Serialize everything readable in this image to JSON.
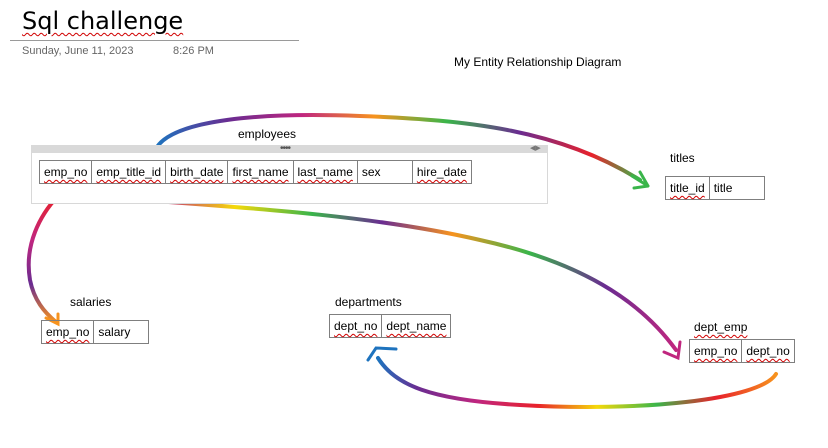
{
  "page": {
    "title": "Sql challenge",
    "date": "Sunday, June 11, 2023",
    "time": "8:26 PM"
  },
  "diagram": {
    "label": "My Entity Relationship Diagram",
    "tables": {
      "employees": {
        "name": "employees",
        "columns": [
          "emp_no",
          "emp_title_id",
          "birth_date",
          "first_name",
          "last_name",
          "sex",
          "hire_date"
        ]
      },
      "titles": {
        "name": "titles",
        "columns": [
          "title_id",
          "title"
        ]
      },
      "salaries": {
        "name": "salaries",
        "columns": [
          "emp_no",
          "salary"
        ]
      },
      "departments": {
        "name": "departments",
        "columns": [
          "dept_no",
          "dept_name"
        ]
      },
      "dept_emp": {
        "name": "dept_emp",
        "columns": [
          "emp_no",
          "dept_no"
        ]
      }
    },
    "relationships": [
      {
        "from": "employees",
        "to": "titles"
      },
      {
        "from": "employees",
        "to": "salaries"
      },
      {
        "from": "employees",
        "to": "dept_emp"
      },
      {
        "from": "dept_emp",
        "to": "departments"
      }
    ],
    "arrow_colors": [
      "#e8212b",
      "#f7931e",
      "#f5d90a",
      "#3ab54a",
      "#1e73be",
      "#6a2c91",
      "#c0267f"
    ]
  },
  "icons": {
    "grip": "grip-dots-icon",
    "scroll": "scroll-arrows-icon"
  }
}
